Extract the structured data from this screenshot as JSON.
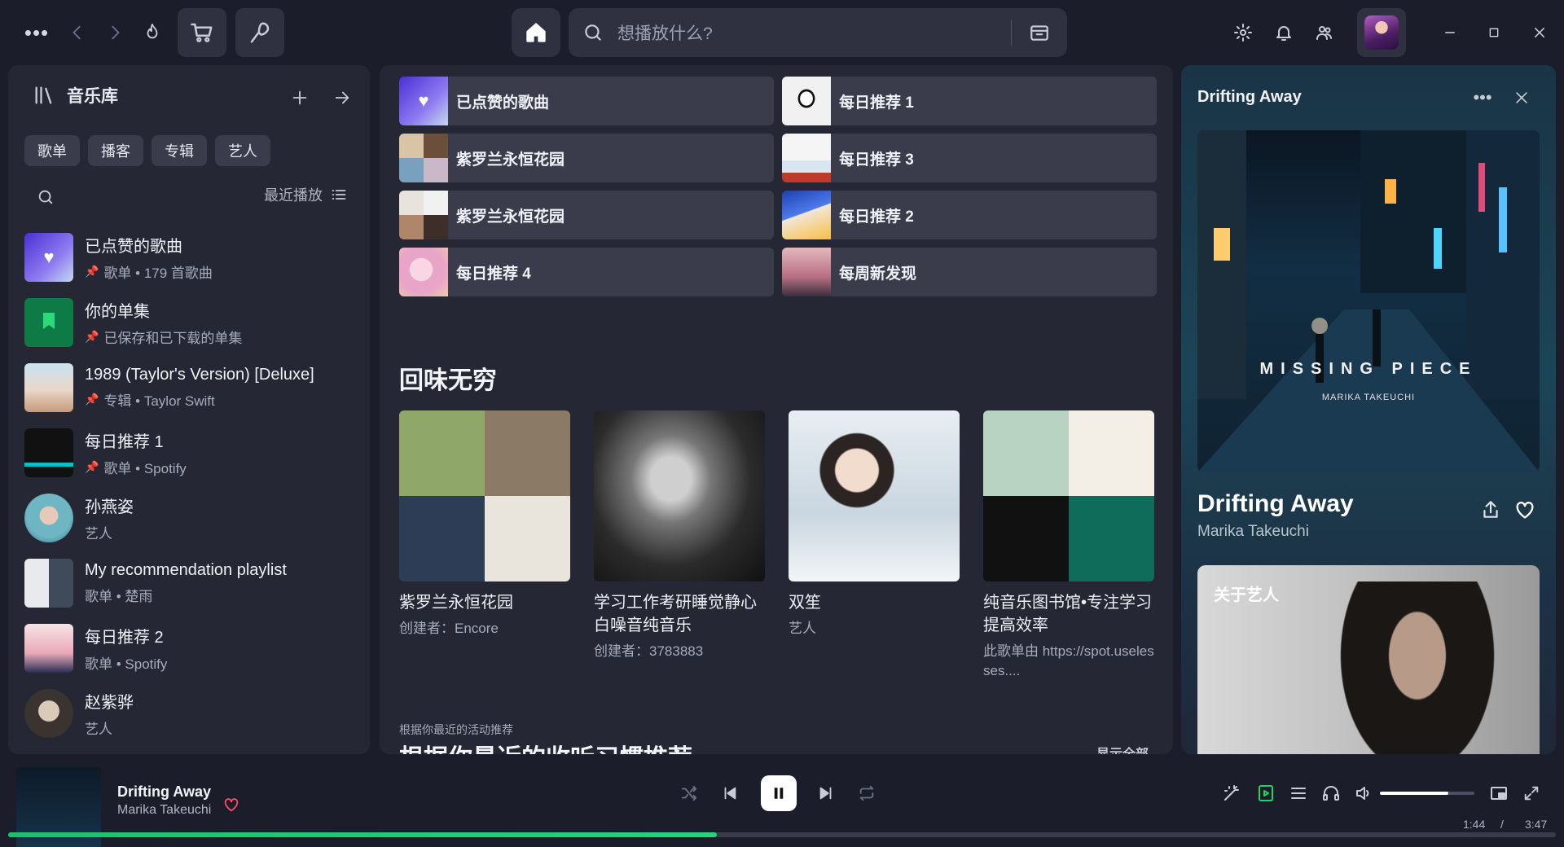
{
  "topbar": {
    "search_placeholder": "想播放什么?"
  },
  "library": {
    "title": "音乐库",
    "filters": [
      "歌单",
      "播客",
      "专辑",
      "艺人"
    ],
    "sort_label": "最近播放",
    "items": [
      {
        "name": "已点赞的歌曲",
        "sub": "歌单 • 179 首歌曲",
        "pinned": true
      },
      {
        "name": "你的单集",
        "sub": "已保存和已下载的单集",
        "pinned": true
      },
      {
        "name": "1989 (Taylor's Version) [Deluxe]",
        "sub": "专辑 • Taylor Swift",
        "pinned": true
      },
      {
        "name": "每日推荐 1",
        "sub": "歌单 • Spotify",
        "pinned": true
      },
      {
        "name": "孙燕姿",
        "sub": "艺人",
        "pinned": false
      },
      {
        "name": "My recommendation playlist",
        "sub": "歌单 • 楚雨",
        "pinned": false
      },
      {
        "name": "每日推荐 2",
        "sub": "歌单 • Spotify",
        "pinned": false
      },
      {
        "name": "赵紫骅",
        "sub": "艺人",
        "pinned": false
      }
    ]
  },
  "main": {
    "tiles": [
      "已点赞的歌曲",
      "每日推荐 1",
      "紫罗兰永恒花园",
      "每日推荐 3",
      "紫罗兰永恒花园",
      "每日推荐 2",
      "每日推荐 4",
      "每周新发现"
    ],
    "section_title": "回味无穷",
    "cards": [
      {
        "title": "紫罗兰永恒花园",
        "sub": "创建者：Encore"
      },
      {
        "title": "学习工作考研睡觉静心白噪音纯音乐",
        "sub": "创建者：3783883"
      },
      {
        "title": "双笙",
        "sub": "艺人"
      },
      {
        "title": "纯音乐图书馆•专注学习提高效率",
        "sub": "此歌单由 https://spot.uselesses...."
      }
    ],
    "rec_caption": "根据你最近的活动推荐",
    "rec_title": "根据你最近的收听习惯推荐",
    "show_all": "显示全部"
  },
  "now_playing_panel": {
    "title": "Drifting Away",
    "song": "Drifting Away",
    "artist": "Marika Takeuchi",
    "art_text": "MISSING PIECE",
    "art_subtext": "MARIKA TAKEUCHI",
    "about_title": "关于艺人"
  },
  "player": {
    "song": "Drifting Away",
    "artist": "Marika Takeuchi",
    "time_current": "1:44",
    "time_sep": "/",
    "time_total": "3:47",
    "volume": 0.72,
    "progress": 0.458
  },
  "colors": {
    "accent_green": "#1ed760",
    "heart_red": "#ff4d6a",
    "pin_blue": "#4a82ff"
  }
}
